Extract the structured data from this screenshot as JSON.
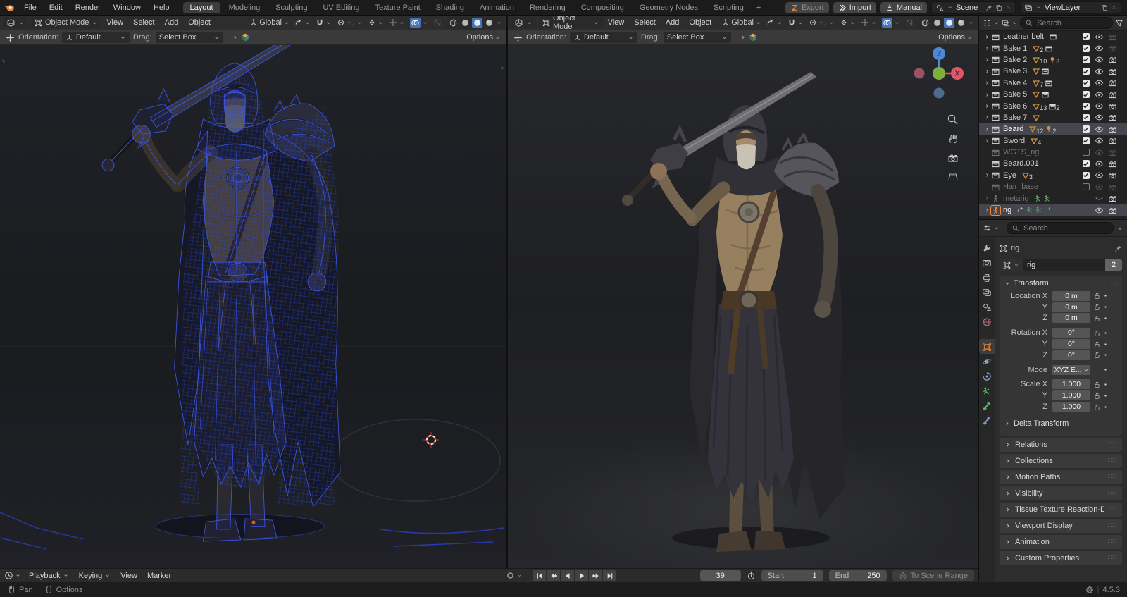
{
  "topbar": {
    "menus": [
      "File",
      "Edit",
      "Render",
      "Window",
      "Help"
    ],
    "workspaces": [
      "Layout",
      "Modeling",
      "Sculpting",
      "UV Editing",
      "Texture Paint",
      "Shading",
      "Animation",
      "Rendering",
      "Compositing",
      "Geometry Nodes",
      "Scripting"
    ],
    "active_workspace": "Layout",
    "add_workspace_label": "+",
    "export_label": "Export",
    "import_label": "Import",
    "manual_label": "Manual",
    "scene": {
      "label": "Scene"
    },
    "view_layer": {
      "label": "ViewLayer"
    }
  },
  "viewport": {
    "mode": "Object Mode",
    "menus": [
      "View",
      "Select",
      "Add",
      "Object"
    ],
    "orientation": "Global",
    "tool_settings": {
      "orientation_label": "Orientation:",
      "orientation_value": "Default",
      "drag_label": "Drag:",
      "drag_value": "Select Box",
      "options_label": "Options"
    },
    "gizmo": {
      "z": "Z",
      "x": "X"
    }
  },
  "outliner": {
    "search_placeholder": "Search",
    "rows": [
      {
        "name": "Leather belt",
        "icon": "collection",
        "expand": true,
        "dim": false,
        "selected": false,
        "badges": [
          {
            "t": "box"
          }
        ],
        "check": "on",
        "eye": "on",
        "cam": "dim"
      },
      {
        "name": "Bake 1",
        "icon": "collection",
        "expand": true,
        "dim": false,
        "selected": false,
        "badges": [
          {
            "t": "mesh",
            "n": "2"
          },
          {
            "t": "box"
          }
        ],
        "check": "on",
        "eye": "on",
        "cam": "dim"
      },
      {
        "name": "Bake 2",
        "icon": "collection",
        "expand": true,
        "dim": false,
        "selected": false,
        "badges": [
          {
            "t": "mesh",
            "n": "10"
          },
          {
            "t": "light",
            "n": "3"
          }
        ],
        "check": "on",
        "eye": "on",
        "cam": "on"
      },
      {
        "name": "Bake 3",
        "icon": "collection",
        "expand": true,
        "dim": false,
        "selected": false,
        "badges": [
          {
            "t": "mesh"
          },
          {
            "t": "box"
          }
        ],
        "check": "on",
        "eye": "on",
        "cam": "on"
      },
      {
        "name": "Bake 4",
        "icon": "collection",
        "expand": true,
        "dim": false,
        "selected": false,
        "badges": [
          {
            "t": "mesh",
            "n": "7"
          },
          {
            "t": "box"
          }
        ],
        "check": "on",
        "eye": "on",
        "cam": "on"
      },
      {
        "name": "Bake 5",
        "icon": "collection",
        "expand": true,
        "dim": false,
        "selected": false,
        "badges": [
          {
            "t": "mesh"
          },
          {
            "t": "box"
          }
        ],
        "check": "on",
        "eye": "on",
        "cam": "on"
      },
      {
        "name": "Bake 6",
        "icon": "collection",
        "expand": true,
        "dim": false,
        "selected": false,
        "badges": [
          {
            "t": "mesh",
            "n": "13"
          },
          {
            "t": "box",
            "n": "2"
          }
        ],
        "check": "on",
        "eye": "on",
        "cam": "on"
      },
      {
        "name": "Bake 7",
        "icon": "collection",
        "expand": true,
        "dim": false,
        "selected": false,
        "badges": [
          {
            "t": "mesh"
          }
        ],
        "check": "on",
        "eye": "on",
        "cam": "on"
      },
      {
        "name": "Beard",
        "icon": "collection",
        "expand": true,
        "dim": false,
        "selected": true,
        "badges": [
          {
            "t": "mesh",
            "n": "12"
          },
          {
            "t": "light",
            "n": "2"
          }
        ],
        "check": "on",
        "eye": "on",
        "cam": "on"
      },
      {
        "name": "Sword",
        "icon": "collection",
        "expand": true,
        "dim": false,
        "selected": false,
        "badges": [
          {
            "t": "mesh",
            "n": "4"
          }
        ],
        "check": "on",
        "eye": "on",
        "cam": "on"
      },
      {
        "name": "WGTS_rig",
        "icon": "collection",
        "expand": false,
        "dim": true,
        "selected": false,
        "badges": [],
        "check": "off",
        "eye": "dim",
        "cam": "dim"
      },
      {
        "name": "Beard.001",
        "icon": "collection",
        "expand": false,
        "dim": false,
        "selected": false,
        "badges": [],
        "check": "on",
        "eye": "on",
        "cam": "on"
      },
      {
        "name": "Eye",
        "icon": "collection",
        "expand": true,
        "dim": false,
        "selected": false,
        "badges": [
          {
            "t": "mesh",
            "n": "3"
          }
        ],
        "check": "on",
        "eye": "on",
        "cam": "on"
      },
      {
        "name": "Hair_base",
        "icon": "collection",
        "expand": false,
        "dim": true,
        "selected": false,
        "badges": [],
        "check": "off",
        "eye": "dim",
        "cam": "dim"
      },
      {
        "name": "metarig",
        "icon": "armature",
        "expand": true,
        "dim": true,
        "selected": false,
        "badges": [
          {
            "t": "pose"
          },
          {
            "t": "pose"
          }
        ],
        "check": null,
        "eye": "closed",
        "cam": "on"
      },
      {
        "name": "rig",
        "icon": "armature-active",
        "expand": true,
        "dim": false,
        "selected": true,
        "badges": [
          {
            "t": "link"
          },
          {
            "t": "pose"
          },
          {
            "t": "pose"
          },
          {
            "t": "tick"
          }
        ],
        "check": null,
        "eye": "on",
        "cam": "on"
      }
    ]
  },
  "properties": {
    "search_placeholder": "Search",
    "breadcrumb": "rig",
    "name_value": "rig",
    "users_badge": "2",
    "transform_title": "Transform",
    "rows": [
      {
        "label": "Location X",
        "value": "0 m",
        "lock": true,
        "group": "loc"
      },
      {
        "label": "Y",
        "value": "0 m",
        "lock": true,
        "group": "loc"
      },
      {
        "label": "Z",
        "value": "0 m",
        "lock": true,
        "group": "loc"
      },
      {
        "label": "Rotation X",
        "value": "0°",
        "lock": true,
        "group": "rot"
      },
      {
        "label": "Y",
        "value": "0°",
        "lock": true,
        "group": "rot"
      },
      {
        "label": "Z",
        "value": "0°",
        "lock": true,
        "group": "rot"
      },
      {
        "label": "Mode",
        "value": "XYZ E...",
        "lock": false,
        "dropdown": true,
        "group": "mode"
      },
      {
        "label": "Scale X",
        "value": "1.000",
        "lock": true,
        "group": "scale"
      },
      {
        "label": "Y",
        "value": "1.000",
        "lock": true,
        "group": "scale"
      },
      {
        "label": "Z",
        "value": "1.000",
        "lock": true,
        "group": "scale"
      }
    ],
    "delta_label": "Delta Transform",
    "panels": [
      "Relations",
      "Collections",
      "Motion Paths",
      "Visibility",
      "Tissue Texture Reaction-Diffusi",
      "Viewport Display",
      "Animation",
      "Custom Properties"
    ],
    "tabs": [
      "tool",
      "render",
      "output",
      "view-layer",
      "scene",
      "world",
      "object",
      "physics",
      "constraints",
      "object-data",
      "bone",
      "bone-constraints"
    ],
    "active_tab": "object"
  },
  "timeline": {
    "menus": [
      {
        "label": "Playback",
        "chev": true
      },
      {
        "label": "Keying",
        "chev": true
      },
      {
        "label": "View",
        "chev": false
      },
      {
        "label": "Marker",
        "chev": false
      }
    ],
    "current_frame": "39",
    "start_label": "Start",
    "start_value": "1",
    "end_label": "End",
    "end_value": "250",
    "to_scene_range_label": "To Scene Range"
  },
  "status": {
    "pan_label": "Pan",
    "options_label": "Options",
    "version": "4.5.3"
  },
  "colors": {
    "accent_orange": "#e8883d",
    "accent_blue": "#4772b3",
    "wire_blue": "#3b57e6",
    "axis_x": "#e0566b",
    "axis_y": "#7fae3c",
    "axis_z": "#4f87d7"
  }
}
